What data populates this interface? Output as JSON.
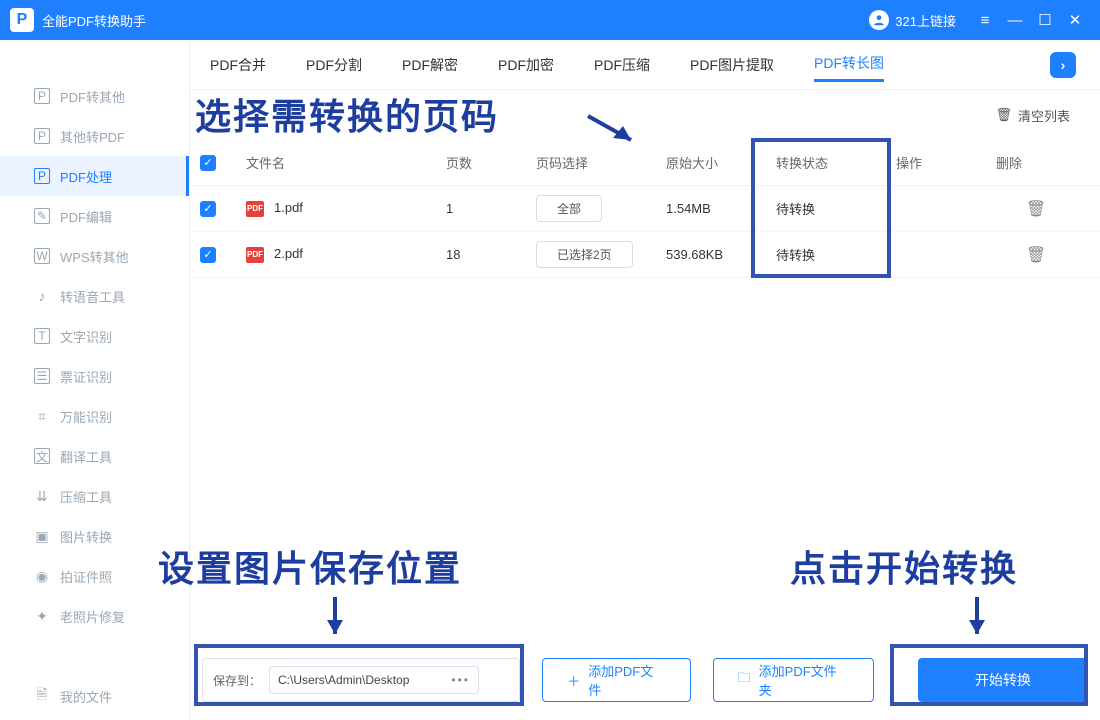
{
  "titlebar": {
    "app_name": "全能PDF转换助手",
    "user_label": "321上链接"
  },
  "sidebar": {
    "items": [
      {
        "label": "PDF转其他"
      },
      {
        "label": "其他转PDF"
      },
      {
        "label": "PDF处理"
      },
      {
        "label": "PDF编辑"
      },
      {
        "label": "WPS转其他"
      },
      {
        "label": "转语音工具"
      },
      {
        "label": "文字识别"
      },
      {
        "label": "票证识别"
      },
      {
        "label": "万能识别"
      },
      {
        "label": "翻译工具"
      },
      {
        "label": "压缩工具"
      },
      {
        "label": "图片转换"
      },
      {
        "label": "拍证件照"
      },
      {
        "label": "老照片修复"
      }
    ],
    "bottom_label": "我的文件"
  },
  "tabs": {
    "items": [
      {
        "label": "PDF合并"
      },
      {
        "label": "PDF分割"
      },
      {
        "label": "PDF解密"
      },
      {
        "label": "PDF加密"
      },
      {
        "label": "PDF压缩"
      },
      {
        "label": "PDF图片提取"
      },
      {
        "label": "PDF转长图"
      }
    ]
  },
  "toolbar": {
    "clear_label": "清空列表"
  },
  "table": {
    "headers": {
      "name": "文件名",
      "pages": "页数",
      "pagesel": "页码选择",
      "size": "原始大小",
      "status": "转换状态",
      "op": "操作",
      "del": "删除"
    },
    "rows": [
      {
        "name": "1.pdf",
        "pages": "1",
        "pagesel": "全部",
        "size": "1.54MB",
        "status": "待转换"
      },
      {
        "name": "2.pdf",
        "pages": "18",
        "pagesel": "已选择2页",
        "size": "539.68KB",
        "status": "待转换"
      }
    ]
  },
  "bottom": {
    "save_to_label": "保存到：",
    "save_path": "C:\\Users\\Admin\\Desktop",
    "add_file_label": "添加PDF文件",
    "add_folder_label": "添加PDF文件夹",
    "start_label": "开始转换"
  },
  "annotations": {
    "a1": "选择需转换的页码",
    "a2": "设置图片保存位置",
    "a3": "点击开始转换"
  }
}
